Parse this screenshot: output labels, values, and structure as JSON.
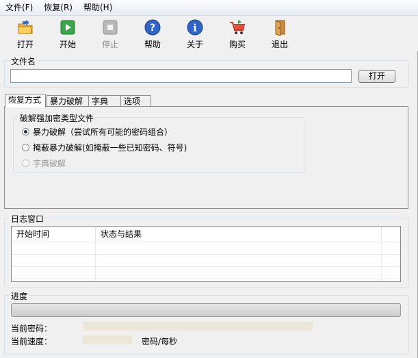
{
  "menu": {
    "file": "文件(F)",
    "recover": "恢复(R)",
    "help": "帮助(H)"
  },
  "toolbar": {
    "open": "打开",
    "start": "开始",
    "stop": "停止",
    "help": "帮助",
    "about": "关于",
    "buy": "购买",
    "exit": "退出"
  },
  "file_section": {
    "title": "文件名",
    "path_value": "",
    "open_button": "打开"
  },
  "tabs": [
    "恢复方式",
    "暴力破解",
    "字典",
    "选项"
  ],
  "attack_group": {
    "title": "破解强加密类型文件",
    "options": [
      {
        "label": "暴力破解（尝试所有可能的密码组合）",
        "checked": true,
        "enabled": true
      },
      {
        "label": "掩蔽暴力破解(如掩蔽一些已知密码、符号)",
        "checked": false,
        "enabled": true
      },
      {
        "label": "字典破解",
        "checked": false,
        "enabled": false
      }
    ]
  },
  "log": {
    "title": "日志窗口",
    "columns": [
      "开始时间",
      "状态与结果"
    ],
    "rows": []
  },
  "progress": {
    "title": "进度",
    "value": 0,
    "current_password_label": "当前密码：",
    "current_password_value": "",
    "current_speed_label": "当前速度：",
    "current_speed_value": "",
    "speed_unit": "密码/每秒"
  }
}
